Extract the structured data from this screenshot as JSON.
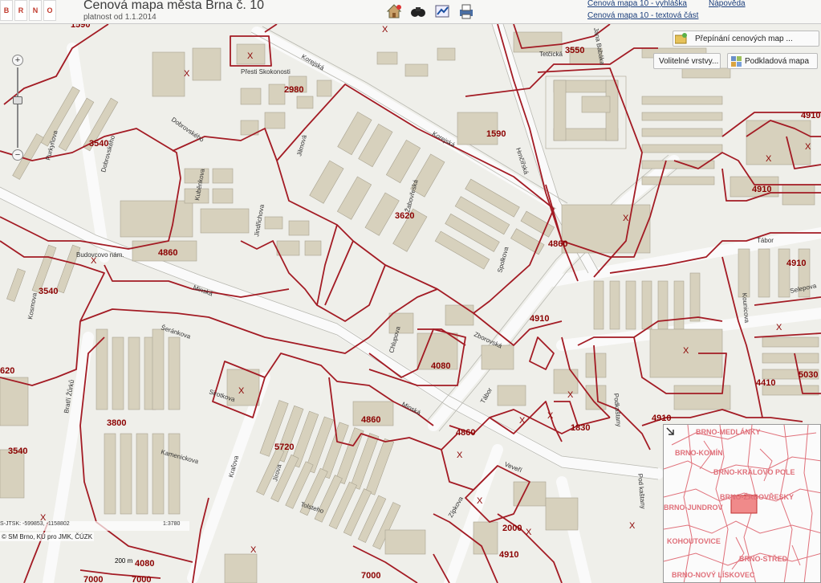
{
  "header": {
    "logo_letters": [
      "B",
      "R",
      "N",
      "O"
    ],
    "title": "Cenová mapa města Brna č. 10",
    "subtitle": "platnost od 1.1.2014",
    "links": {
      "vyhlaska": "Cenová mapa 10 - vyhláška",
      "textova": "Cenová mapa 10 - textová část",
      "napoveda": "Nápověda"
    },
    "tools": [
      "home-icon",
      "binoculars-icon",
      "measure-icon",
      "print-icon"
    ]
  },
  "controls": {
    "switch_maps": "Přepínání cenových map ...",
    "optional_layers": "Volitelné vrstvy...",
    "base_map": "Podkladová mapa",
    "zoom_in": "+",
    "zoom_out": "−"
  },
  "map": {
    "price_labels": [
      "1590",
      "2980",
      "3540",
      "1590",
      "3550",
      "4910",
      "4910",
      "3620",
      "4860",
      "4860",
      "4910",
      "3540",
      "4080",
      "4910",
      "620",
      "3800",
      "5720",
      "4860",
      "4860",
      "1830",
      "4910",
      "4410",
      "5030",
      "3540",
      "2000",
      "4910",
      "7000",
      "7000",
      "7000",
      "4080"
    ],
    "x_marker": "X",
    "streets": [
      "Korejská",
      "Jana Babáka",
      "Tetčická",
      "Hrnčířská",
      "Purkyňova",
      "Dobrovského",
      "Kuběnkova",
      "Jindřichova",
      "Jilmová",
      "Kounicova",
      "Minská",
      "Kosmova",
      "Šeránkova",
      "Sirotkova",
      "Kamenickova",
      "Kraľova",
      "Jírova",
      "Bratří Žůrků",
      "Budovcovo nám.",
      "Zborovská",
      "Spolkova",
      "Chlupova",
      "Žabovřeská",
      "Tábor",
      "Podkaštany",
      "Veveří",
      "Selepova",
      "Tolsteho",
      "Zípkova",
      "Pod kaštany"
    ],
    "other_text": [
      "Přesti Skokonosti"
    ]
  },
  "overview": {
    "labels": [
      "BRNO-MEDLÁNKY",
      "BRNO-KOMÍN",
      "BRNO-KRÁLOVO POLE",
      "BRNO-ŽABOVŘESKY",
      "BRNO-JUNDROV",
      "KOHOUTOVICE",
      "BRNO-STŘED",
      "BRNO-NOVÝ LÍSKOVEC"
    ]
  },
  "footer": {
    "coords": "S-JTSK: -599853, -1158802",
    "scale": "1:3780",
    "copyright": "© SM Brno, KÚ pro JMK, ČÚZK",
    "scalebar": "200 m"
  },
  "colors": {
    "boundary": "#a31b24",
    "building": "#d7d1bd",
    "overview_line": "#e0707a",
    "highlight": "#f08a8a"
  }
}
